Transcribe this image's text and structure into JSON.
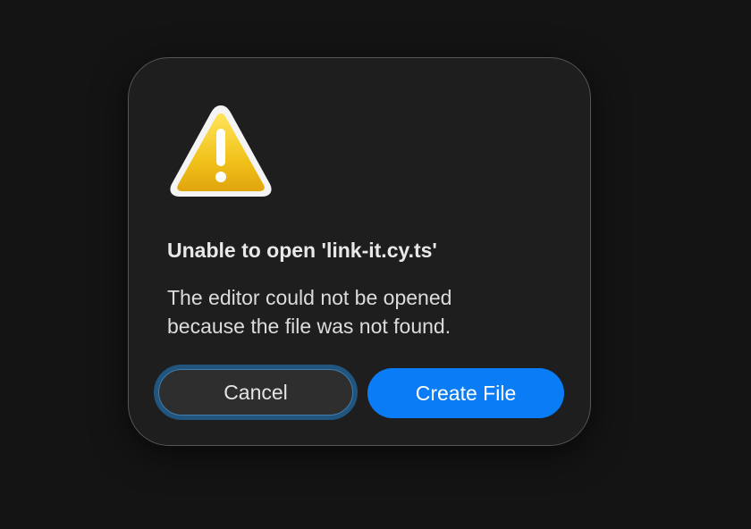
{
  "dialog": {
    "icon": "warning-triangle-icon",
    "title": "Unable to open 'link-it.cy.ts'",
    "message_lines": [
      "The editor could not be opened",
      "because the file was not found."
    ],
    "cancel_label": "Cancel",
    "create_label": "Create File"
  },
  "colors": {
    "background": "#141414",
    "dialog_bg": "#1e1e1e",
    "accent": "#0a7cf5",
    "focus_ring": "#22557e",
    "warning": "#f2c11a"
  }
}
